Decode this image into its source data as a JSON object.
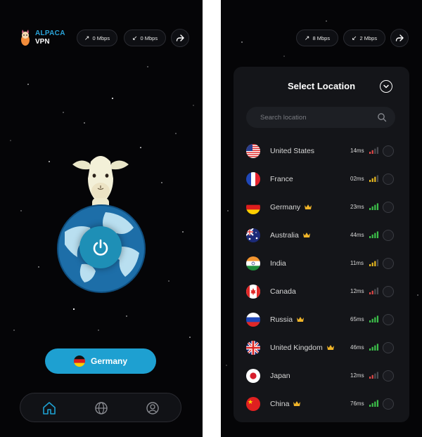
{
  "brand": {
    "name": "ALPACA",
    "sub": "VPN",
    "accent": "#2aa3d8"
  },
  "left": {
    "upload": "0 Mbps",
    "download": "0 Mbps",
    "selected_country": "Germany",
    "button_color": "#1ea0d1",
    "nav": [
      "home-icon",
      "globe-icon",
      "profile-icon"
    ]
  },
  "right": {
    "upload": "8 Mbps",
    "download": "2 Mbps",
    "title": "Select Location",
    "search_placeholder": "Search location",
    "locations": [
      {
        "name": "United States",
        "ping": "14ms",
        "signal": 2,
        "signal_color": "#e04848",
        "premium": false,
        "flag": "us"
      },
      {
        "name": "France",
        "ping": "02ms",
        "signal": 3,
        "signal_color": "#e8b820",
        "premium": false,
        "flag": "fr"
      },
      {
        "name": "Germany",
        "ping": "23ms",
        "signal": 4,
        "signal_color": "#3cc04a",
        "premium": true,
        "flag": "de"
      },
      {
        "name": "Australia",
        "ping": "44ms",
        "signal": 4,
        "signal_color": "#3cc04a",
        "premium": true,
        "flag": "au"
      },
      {
        "name": "India",
        "ping": "11ms",
        "signal": 3,
        "signal_color": "#e8b820",
        "premium": false,
        "flag": "in"
      },
      {
        "name": "Canada",
        "ping": "12ms",
        "signal": 2,
        "signal_color": "#e04848",
        "premium": false,
        "flag": "ca"
      },
      {
        "name": "Russia",
        "ping": "65ms",
        "signal": 4,
        "signal_color": "#3cc04a",
        "premium": true,
        "flag": "ru"
      },
      {
        "name": "United Kingdom",
        "ping": "46ms",
        "signal": 4,
        "signal_color": "#3cc04a",
        "premium": true,
        "flag": "gb"
      },
      {
        "name": "Japan",
        "ping": "12ms",
        "signal": 2,
        "signal_color": "#e04848",
        "premium": false,
        "flag": "jp"
      },
      {
        "name": "China",
        "ping": "76ms",
        "signal": 4,
        "signal_color": "#3cc04a",
        "premium": true,
        "flag": "cn"
      }
    ]
  }
}
